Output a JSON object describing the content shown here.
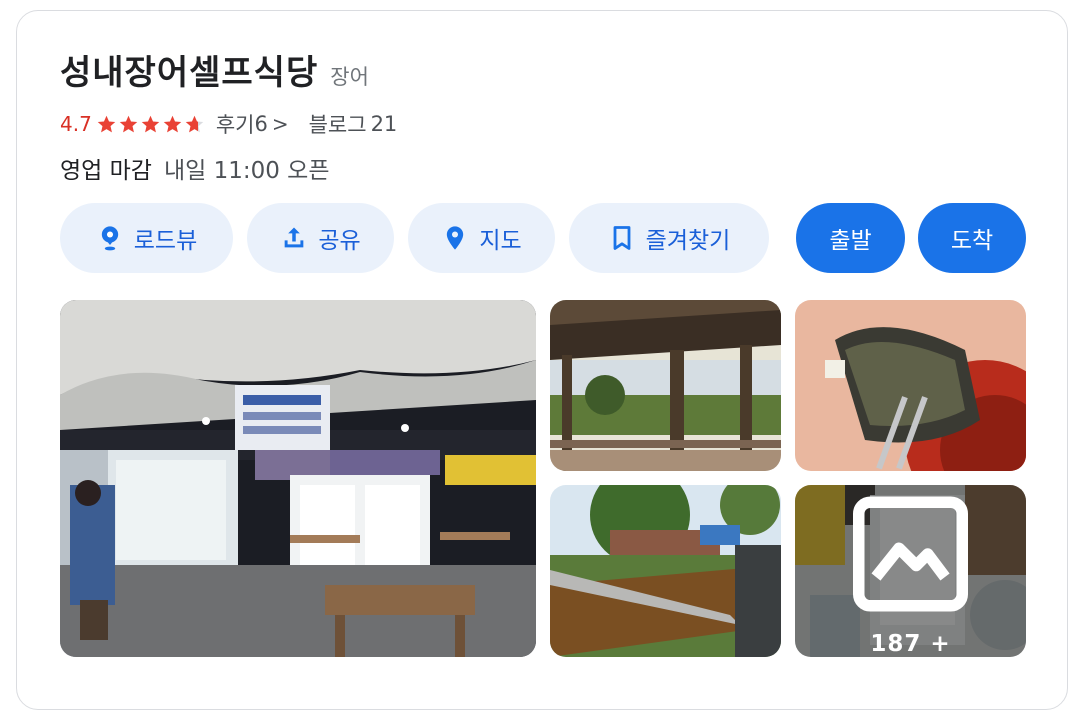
{
  "place": {
    "name": "성내장어셀프식당",
    "category": "장어",
    "rating": "4.7",
    "rating_value": 4.7,
    "reviews_label": "후기",
    "reviews_count": "6",
    "reviews_chevron": ">",
    "blog_label": "블로그",
    "blog_count": "21",
    "status": "영업 마감",
    "hours_detail": "내일 11:00 오픈"
  },
  "actions": {
    "roadview": "로드뷰",
    "share": "공유",
    "map": "지도",
    "save": "즐겨찾기",
    "depart": "출발",
    "arrive": "도착"
  },
  "photos": {
    "more_count": "187 +"
  },
  "colors": {
    "accent": "#1a73e8",
    "chip_bg": "#eaf1fb",
    "star": "#e94235",
    "rating_text": "#d93025"
  },
  "icons": {
    "roadview": "roadview-pin-icon",
    "share": "share-upload-icon",
    "map": "map-pin-icon",
    "save": "bookmark-icon",
    "more_photos": "photo-gallery-icon"
  }
}
